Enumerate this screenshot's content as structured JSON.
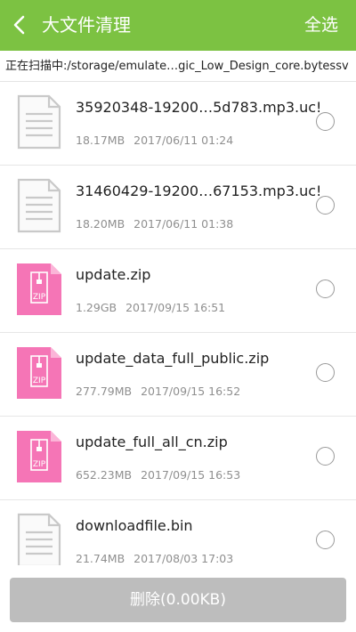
{
  "header": {
    "title": "大文件清理",
    "select_all": "全选",
    "bg_color": "#7cc242"
  },
  "scan": {
    "text": "正在扫描中:/storage/emulate…gic_Low_Design_core.bytessv"
  },
  "files": [
    {
      "name": "35920348-19200…5d783.mp3.uc!",
      "size": "18.17MB",
      "date": "2017/06/11 01:24",
      "icon": "document-file-icon"
    },
    {
      "name": "31460429-19200…67153.mp3.uc!",
      "size": "18.20MB",
      "date": "2017/06/11 01:38",
      "icon": "document-file-icon"
    },
    {
      "name": "update.zip",
      "size": "1.29GB",
      "date": "2017/09/15 16:51",
      "icon": "zip-file-icon"
    },
    {
      "name": "update_data_full_public.zip",
      "size": "277.79MB",
      "date": "2017/09/15 16:52",
      "icon": "zip-file-icon"
    },
    {
      "name": "update_full_all_cn.zip",
      "size": "652.23MB",
      "date": "2017/09/15 16:53",
      "icon": "zip-file-icon"
    },
    {
      "name": "downloadfile.bin",
      "size": "21.74MB",
      "date": "2017/08/03 17:03",
      "icon": "document-file-icon"
    }
  ],
  "footer": {
    "delete_label": "删除(0.00KB)"
  }
}
